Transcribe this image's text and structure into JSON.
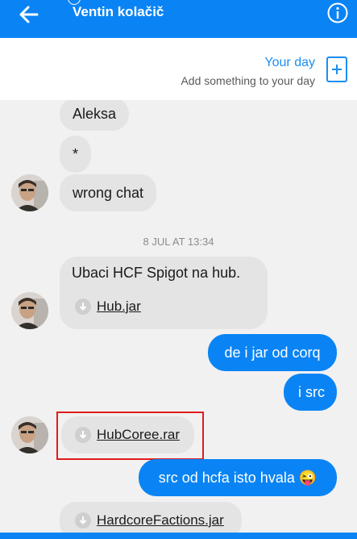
{
  "header": {
    "back_icon": "arrow-left-icon",
    "title": "Ventin kolačič",
    "info_icon": "info-icon",
    "bar_color": "#0a84f4"
  },
  "your_day": {
    "title": "Your day",
    "subtitle": "Add something to your day",
    "add_icon": "add-story-icon"
  },
  "messages": {
    "m1": "Aleksa",
    "m2": "*",
    "m3": "wrong chat",
    "timestamp": "8 JUL AT 13:34",
    "m4": "Ubaci HCF Spigot na hub.",
    "f1": "Hub.jar",
    "m5": "de i jar od corq",
    "m6": "i src",
    "f2": "HubCoree.rar",
    "m7": "src od hcfa isto hvala 😜",
    "f3": "HardcoreFactions.jar"
  },
  "colors": {
    "outgoing_bubble": "#0a84f4",
    "incoming_bubble": "#e4e4e4",
    "highlight": "#e01b1b"
  }
}
